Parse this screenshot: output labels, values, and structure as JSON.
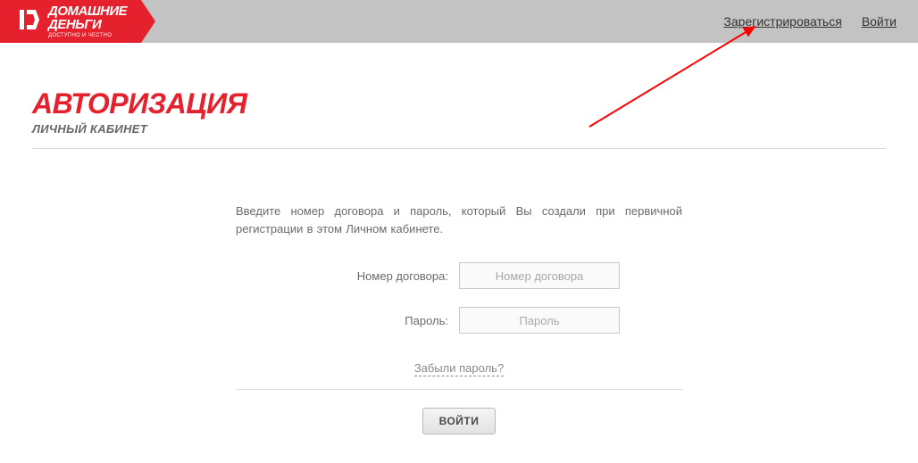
{
  "logo": {
    "line1": "ДОМАШНИЕ",
    "line2": "ДЕНЬГИ",
    "tagline": "ДОСТУПНО И ЧЕСТНО"
  },
  "header": {
    "register_label": "Зарегистрироваться",
    "login_label": "Войти"
  },
  "page": {
    "title": "АВТОРИЗАЦИЯ",
    "subtitle": "ЛИЧНЫЙ КАБИНЕТ"
  },
  "form": {
    "instruction": "Введите номер договора и пароль, который Вы создали при первичной регистрации в этом Личном кабинете.",
    "contract_label": "Номер договора:",
    "contract_placeholder": "Номер договора",
    "password_label": "Пароль:",
    "password_placeholder": "Пароль",
    "forgot_label": "Забыли пароль?",
    "submit_label": "ВОЙТИ"
  },
  "colors": {
    "brand": "#e4212d",
    "header_bg": "#c3c3c3"
  }
}
